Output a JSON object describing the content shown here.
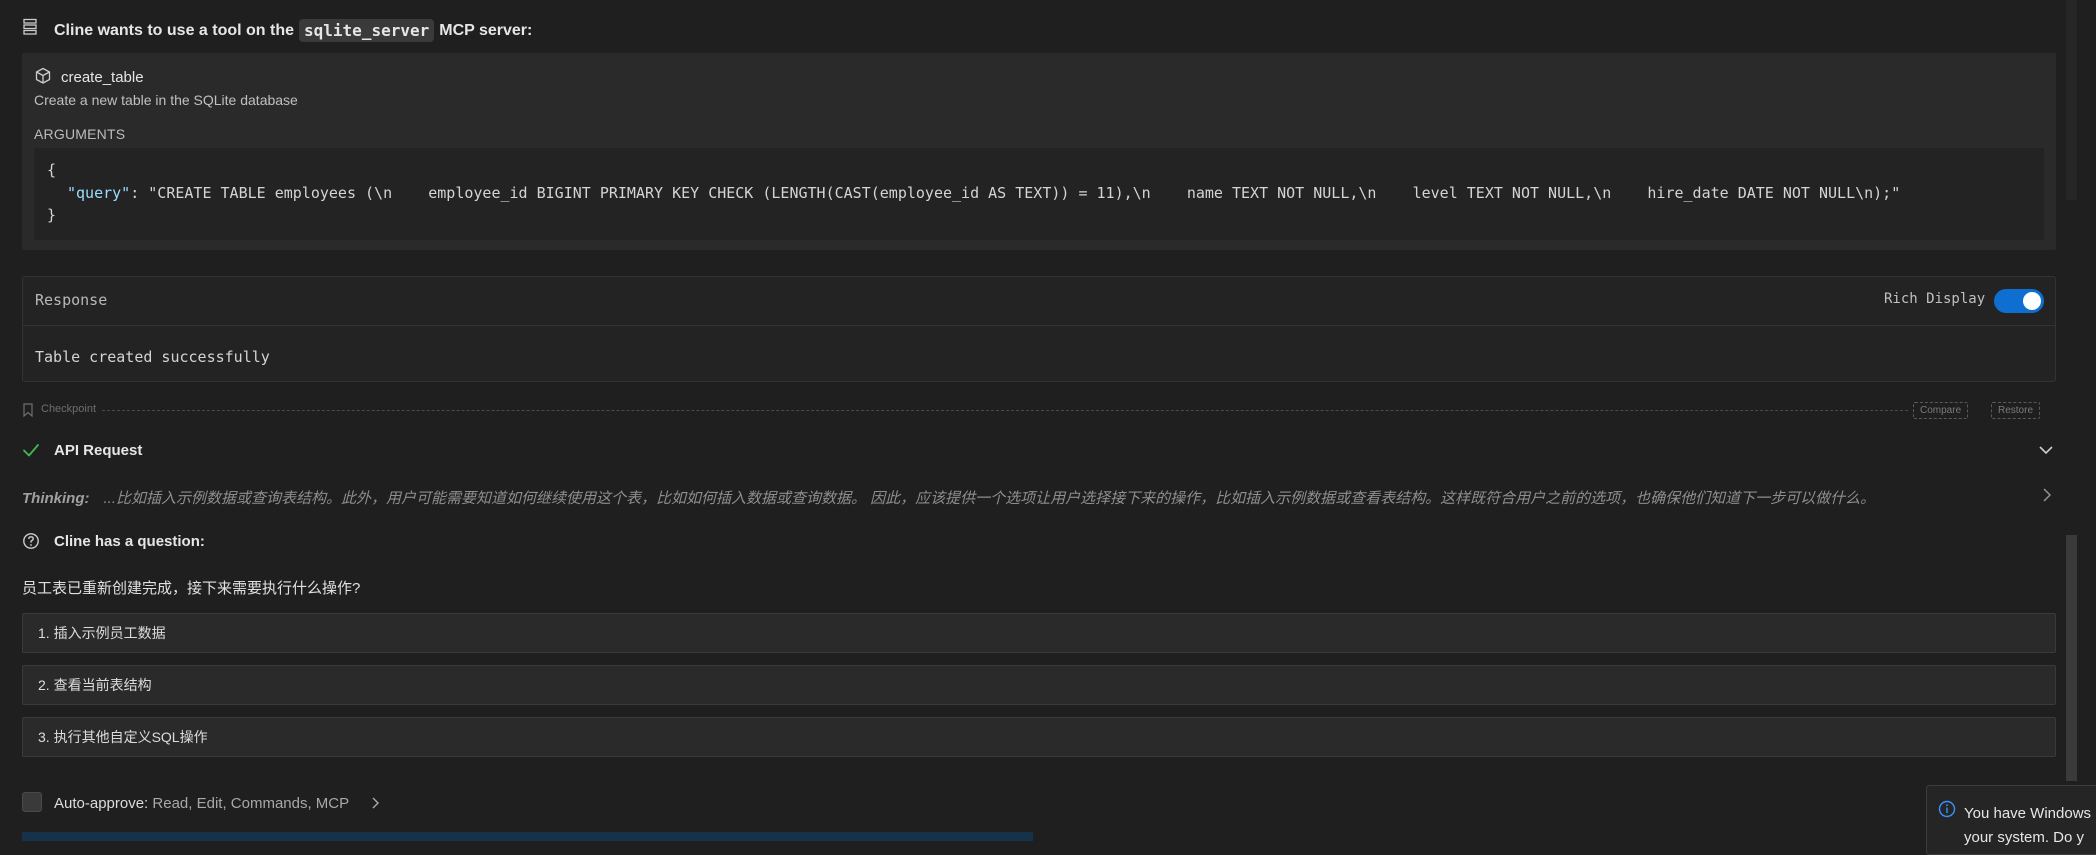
{
  "header": {
    "prefix": "Cline wants to use a tool on the",
    "server": "sqlite_server",
    "suffix": "MCP server:"
  },
  "tool": {
    "name": "create_table",
    "description": "Create a new table in the SQLite database",
    "arguments_label": "ARGUMENTS",
    "open_brace": "{",
    "key": "\"query\"",
    "value": ": \"CREATE TABLE employees (\\n    employee_id BIGINT PRIMARY KEY CHECK (LENGTH(CAST(employee_id AS TEXT)) = 11),\\n    name TEXT NOT NULL,\\n    level TEXT NOT NULL,\\n    hire_date DATE NOT NULL\\n);\"",
    "close_brace": "}"
  },
  "response": {
    "title": "Response",
    "rich_display_label": "Rich Display",
    "rich_display_on": true,
    "text": "Table created successfully"
  },
  "checkpoint": {
    "label": "Checkpoint",
    "compare": "Compare",
    "restore": "Restore"
  },
  "api_request": {
    "label": "API Request"
  },
  "thinking": {
    "label": "Thinking:",
    "text": "...比如插入示例数据或查询表结构。此外，用户可能需要知道如何继续使用这个表，比如如何插入数据或查询数据。 因此，应该提供一个选项让用户选择接下来的操作，比如插入示例数据或查看表结构。这样既符合用户之前的选项，也确保他们知道下一步可以做什么。"
  },
  "question": {
    "label": "Cline has a question:",
    "text": "员工表已重新创建完成，接下来需要执行什么操作?",
    "options": [
      "1. 插入示例员工数据",
      "2. 查看当前表结构",
      "3. 执行其他自定义SQL操作"
    ]
  },
  "auto_approve": {
    "label": "Auto-approve:",
    "items": "Read, Edit, Commands, MCP"
  },
  "toast": {
    "line1": "You have Windows",
    "line2": "your system. Do y"
  },
  "colors": {
    "background": "#1f1f1f",
    "card": "#2a2a2a",
    "accent": "#0e6fd0",
    "json_key": "#9cdcfe",
    "success": "#3fb950"
  },
  "icons": {
    "header": "server-icon",
    "tool": "cube-icon",
    "checkpoint": "bookmark-icon",
    "api": "check-icon",
    "question": "question-circle-icon",
    "toast": "info-icon"
  }
}
